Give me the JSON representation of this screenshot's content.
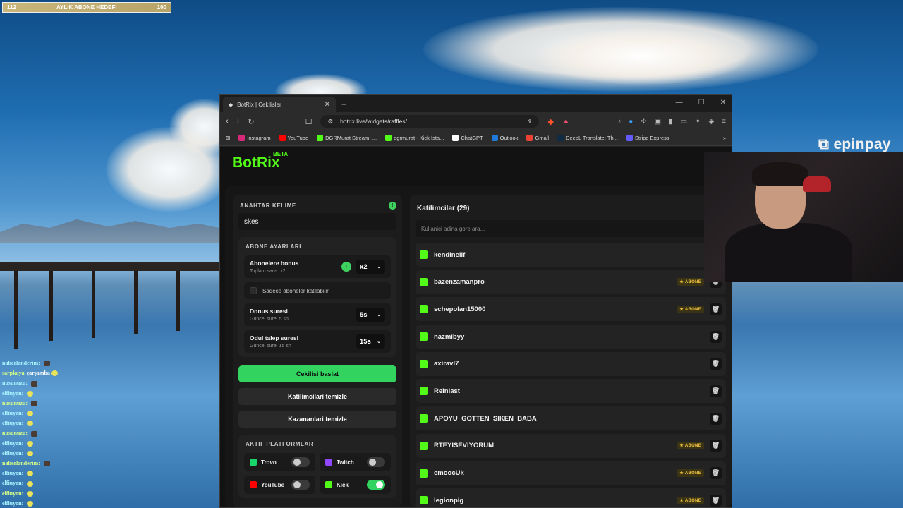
{
  "overlay": {
    "goal": {
      "left_value": "112",
      "label": "AYLIK ABONE HEDEFI",
      "right_value": "100"
    },
    "brand": "epinpay",
    "chat": [
      {
        "name": "naberlanderim:",
        "text": ""
      },
      {
        "name": "sarpkaya",
        "text": "çarşamba"
      },
      {
        "name": "nusunuzu:",
        "text": ""
      },
      {
        "name": "elfiuyon:",
        "text": ""
      },
      {
        "name": "nusunuzu:",
        "text": ""
      },
      {
        "name": "elfiuyon:",
        "text": ""
      },
      {
        "name": "elfiuyon:",
        "text": ""
      },
      {
        "name": "nusunuzu:",
        "text": ""
      },
      {
        "name": "elfiuyon:",
        "text": ""
      },
      {
        "name": "elfiuyon:",
        "text": ""
      },
      {
        "name": "naberlanderim:",
        "text": ""
      },
      {
        "name": "elfiuyon:",
        "text": ""
      },
      {
        "name": "elfiuyon:",
        "text": ""
      },
      {
        "name": "elfiuyon:",
        "text": ""
      },
      {
        "name": "elfiuyon:",
        "text": ""
      }
    ]
  },
  "browser": {
    "tab_title": "BotRix | Cekilisler",
    "url": "botrix.live/widgets/raffles/",
    "bookmarks": [
      {
        "label": "Instagram",
        "color": "#d6297a"
      },
      {
        "label": "YouTube",
        "color": "#ff0000"
      },
      {
        "label": "DGRMurat Stream -...",
        "color": "#53fc18"
      },
      {
        "label": "dgrmurat - Kick İsta...",
        "color": "#53fc18"
      },
      {
        "label": "ChatGPT",
        "color": "#ffffff"
      },
      {
        "label": "Outlook",
        "color": "#1e7ad6"
      },
      {
        "label": "Gmail",
        "color": "#ea4335"
      },
      {
        "label": "DeepL Translate: Th...",
        "color": "#0f2b46"
      },
      {
        "label": "Stripe Express",
        "color": "#635bff"
      }
    ]
  },
  "app": {
    "logo": "BotRix",
    "logo_badge": "BETA",
    "keyword_label": "ANAHTAR KELIME",
    "keyword_value": "skes",
    "sub_settings_label": "ABONE AYARLARI",
    "bonus_title": "Abonelere bonus",
    "bonus_sub": "Toplam sans: x2",
    "bonus_value": "x2",
    "only_subs": "Sadece aboneler katilabilir",
    "spin_title": "Donus suresi",
    "spin_sub": "Guncel sure: 5 sn",
    "spin_value": "5s",
    "claim_title": "Odul talep suresi",
    "claim_sub": "Guncel sure: 15 sn",
    "claim_value": "15s",
    "start_btn": "Cekilisi baslat",
    "clear_participants_btn": "Katilimcilari temizle",
    "clear_winners_btn": "Kazananlari temizle",
    "platforms_label": "AKTIF PLATFORMLAR",
    "platforms": [
      {
        "name": "Trovo",
        "on": false,
        "color": "#19d66b"
      },
      {
        "name": "Twitch",
        "on": false,
        "color": "#9146ff"
      },
      {
        "name": "YouTube",
        "on": false,
        "color": "#ff0000"
      },
      {
        "name": "Kick",
        "on": true,
        "color": "#53fc18"
      }
    ],
    "participants_title": "Katilimcilar (29)",
    "search_placeholder": "Kullanici adina gore ara...",
    "badge_label": "ABONE",
    "participants": [
      {
        "name": "kendinelif",
        "sub": false
      },
      {
        "name": "bazenzamanpro",
        "sub": true
      },
      {
        "name": "schepolan15000",
        "sub": true
      },
      {
        "name": "nazmibyy",
        "sub": false
      },
      {
        "name": "axiravl7",
        "sub": false
      },
      {
        "name": "Reinlast",
        "sub": false
      },
      {
        "name": "APOYU_GOTTEN_SIKEN_BABA",
        "sub": false
      },
      {
        "name": "RTEYISEVIYORUM",
        "sub": true
      },
      {
        "name": "emoocUk",
        "sub": true
      },
      {
        "name": "legionpig",
        "sub": true
      }
    ]
  }
}
